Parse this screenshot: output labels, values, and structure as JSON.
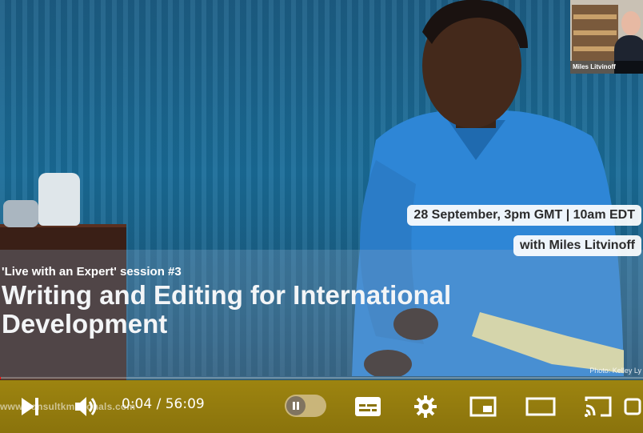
{
  "video": {
    "date_time": "28 September, 3pm GMT | 10am EDT",
    "presenter": "with Miles Litvinoff",
    "session": "'Live with an Expert' session #3",
    "title": "Writing and Editing for International Development",
    "photo_credit": "Photo: Kelley Ly",
    "pip_name": "Miles Litvinoff"
  },
  "player": {
    "watermark": "www.consultkmationals.com",
    "current_time": "0:04",
    "separator": " / ",
    "duration": "56:09",
    "progress_fraction": 0.0012,
    "autoplay_on": false
  },
  "icons": {
    "next": "next-icon",
    "volume": "volume-icon",
    "autoplay": "autoplay-toggle-icon",
    "subtitles": "subtitles-icon",
    "settings": "gear-icon",
    "miniplayer": "miniplayer-icon",
    "theater": "theater-mode-icon",
    "cast": "cast-icon"
  },
  "colors": {
    "control_bar": "#9d8410",
    "progress": "#ff0000",
    "pill_bg": "#ffffff"
  }
}
